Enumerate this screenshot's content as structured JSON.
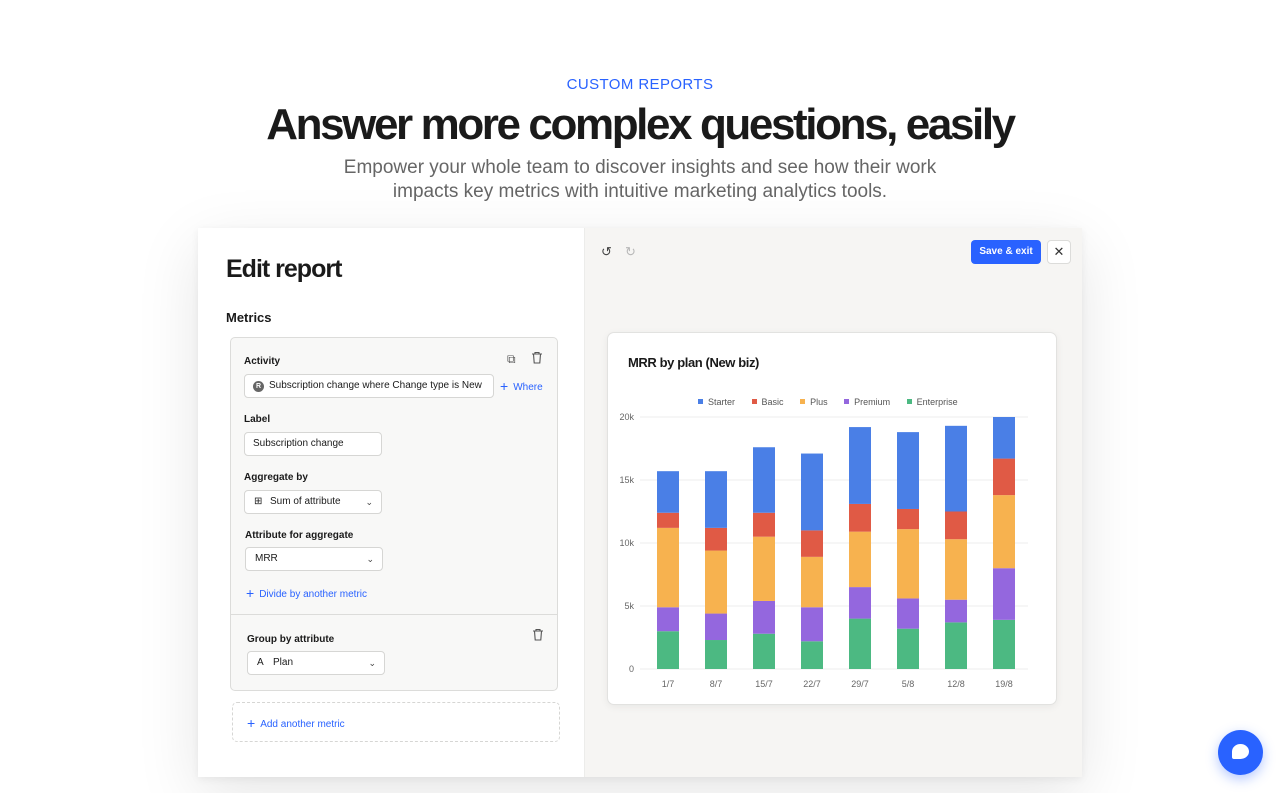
{
  "hero": {
    "eyebrow": "CUSTOM REPORTS",
    "headline": "Answer more complex questions, easily",
    "subhead": "Empower your whole team to discover insights and see how their work impacts key metrics with intuitive marketing analytics tools."
  },
  "editor": {
    "title": "Edit report",
    "metrics_label": "Metrics",
    "activity": {
      "label": "Activity",
      "badge": "R",
      "value": "Subscription change where Change type is New",
      "where_label": "Where"
    },
    "label_field": {
      "label": "Label",
      "value": "Subscription change"
    },
    "aggregate": {
      "label": "Aggregate by",
      "value": "Sum of attribute"
    },
    "attribute": {
      "label": "Attribute for aggregate",
      "value": "MRR"
    },
    "divide_link": "Divide by another metric",
    "group_by": {
      "label": "Group by attribute",
      "value": "Plan"
    },
    "add_metric": "Add another metric",
    "icons": [
      "duplicate-icon",
      "trash-icon",
      "plus-icon",
      "chevron-down-icon",
      "sum-icon",
      "text-attribute-icon"
    ]
  },
  "toolbar": {
    "undo_icon": "undo-icon",
    "redo_icon": "redo-icon",
    "save_label": "Save & exit",
    "close_icon": "close-icon"
  },
  "colors": {
    "accent": "#2962ff",
    "starter": "#4a7fe6",
    "basic": "#e05a45",
    "plus": "#f7b24f",
    "premium": "#9467de",
    "enterprise": "#4cb982"
  },
  "chart_data": {
    "type": "bar",
    "stacked": true,
    "title": "MRR by plan (New biz)",
    "categories": [
      "1/7",
      "8/7",
      "15/7",
      "22/7",
      "29/7",
      "5/8",
      "12/8",
      "19/8"
    ],
    "series": [
      {
        "name": "Enterprise",
        "color": "#4cb982",
        "values": [
          3000,
          2300,
          2800,
          2200,
          4000,
          3200,
          3700,
          3900
        ]
      },
      {
        "name": "Premium",
        "color": "#9467de",
        "values": [
          1900,
          2100,
          2600,
          2700,
          2500,
          2400,
          1800,
          4100
        ]
      },
      {
        "name": "Plus",
        "color": "#f7b24f",
        "values": [
          6300,
          5000,
          5100,
          4000,
          4400,
          5500,
          4800,
          5800
        ]
      },
      {
        "name": "Basic",
        "color": "#e05a45",
        "values": [
          1200,
          1800,
          1900,
          2100,
          2200,
          1600,
          2200,
          2900
        ]
      },
      {
        "name": "Starter",
        "color": "#4a7fe6",
        "values": [
          3300,
          4500,
          5200,
          6100,
          6100,
          6100,
          6800,
          3300
        ]
      }
    ],
    "legend": [
      "Starter",
      "Basic",
      "Plus",
      "Premium",
      "Enterprise"
    ],
    "legend_position": "top",
    "y_ticks": [
      "0",
      "5k",
      "10k",
      "15k",
      "20k"
    ],
    "ylim": [
      0,
      20000
    ],
    "grid": true
  },
  "chat": {
    "icon": "chat-icon"
  }
}
